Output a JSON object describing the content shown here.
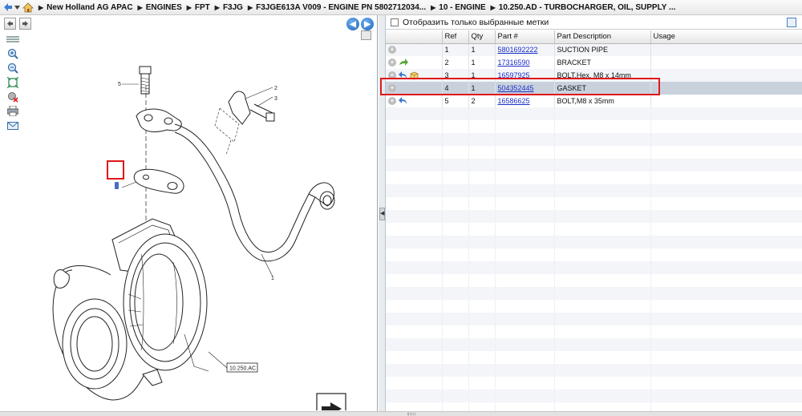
{
  "breadcrumb": [
    "New Holland AG APAC",
    "ENGINES",
    "FPT",
    "F3JG",
    "F3JGE613A V009 - ENGINE PN 5802712034...",
    "10 - ENGINE",
    "10.250.AD - TURBOCHARGER, OIL, SUPPLY ..."
  ],
  "filter": {
    "label": "Отобразить только выбранные метки",
    "checked": false
  },
  "grid": {
    "headers": [
      "",
      "Ref",
      "Qty",
      "Part #",
      "Part Description",
      "Usage"
    ],
    "rows": [
      {
        "ref": "1",
        "qty": "1",
        "part": "5801692222",
        "desc": "SUCTION PIPE",
        "usage": "",
        "icons": []
      },
      {
        "ref": "2",
        "qty": "1",
        "part": "17316590",
        "desc": "BRACKET",
        "usage": "",
        "icons": [
          "green-arrow-icon"
        ]
      },
      {
        "ref": "3",
        "qty": "1",
        "part": "16597925",
        "desc": "BOLT,Hex, M8 x 14mm",
        "usage": "",
        "icons": [
          "blue-return-arrow-icon",
          "package-icon"
        ]
      },
      {
        "ref": "4",
        "qty": "1",
        "part": "504352445",
        "desc": "GASKET",
        "usage": "",
        "icons": [],
        "selected": true
      },
      {
        "ref": "5",
        "qty": "2",
        "part": "16586625",
        "desc": "BOLT,M8 x 35mm",
        "usage": "",
        "icons": [
          "blue-return-arrow-icon"
        ]
      }
    ]
  },
  "drawing": {
    "callouts": [
      "5",
      "2",
      "3",
      "1"
    ],
    "reference_label": "10.250.AC"
  },
  "tools": [
    "zoom-in-icon",
    "zoom-out-icon",
    "fit-icon",
    "clear-icon",
    "print-icon",
    "email-icon"
  ],
  "colors": {
    "highlight": "#e01818",
    "link": "#1a2ec8",
    "selected_row": "#c9d2dc"
  }
}
